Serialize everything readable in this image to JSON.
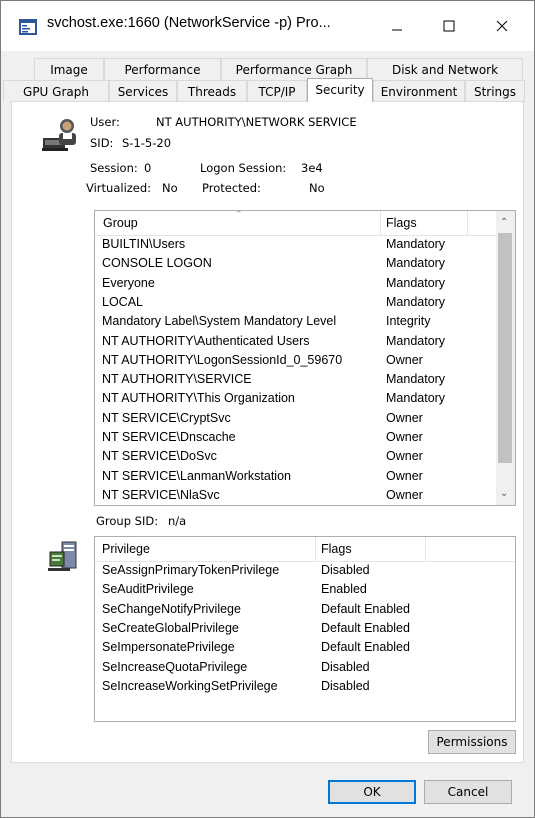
{
  "window": {
    "title": "svchost.exe:1660 (NetworkService -p) Pro..."
  },
  "tabs_row1": [
    "Image",
    "Performance",
    "Performance Graph",
    "Disk and Network"
  ],
  "tabs_row2": [
    "GPU Graph",
    "Services",
    "Threads",
    "TCP/IP",
    "Security",
    "Environment",
    "Strings"
  ],
  "active_tab": "Security",
  "user_info": {
    "user_label": "User:",
    "user_value": "NT AUTHORITY\\NETWORK SERVICE",
    "sid_label": "SID:",
    "sid_value": "S-1-5-20",
    "session_label": "Session:",
    "session_value": "0",
    "logon_session_label": "Logon Session:",
    "logon_session_value": "3e4",
    "virtualized_label": "Virtualized:",
    "virtualized_value": "No",
    "protected_label": "Protected:",
    "protected_value": "No"
  },
  "groups": {
    "columns": [
      "Group",
      "Flags"
    ],
    "rows": [
      [
        "BUILTIN\\Users",
        "Mandatory"
      ],
      [
        "CONSOLE LOGON",
        "Mandatory"
      ],
      [
        "Everyone",
        "Mandatory"
      ],
      [
        "LOCAL",
        "Mandatory"
      ],
      [
        "Mandatory Label\\System Mandatory Level",
        "Integrity"
      ],
      [
        "NT AUTHORITY\\Authenticated Users",
        "Mandatory"
      ],
      [
        "NT AUTHORITY\\LogonSessionId_0_59670",
        "Owner"
      ],
      [
        "NT AUTHORITY\\SERVICE",
        "Mandatory"
      ],
      [
        "NT AUTHORITY\\This Organization",
        "Mandatory"
      ],
      [
        "NT SERVICE\\CryptSvc",
        "Owner"
      ],
      [
        "NT SERVICE\\Dnscache",
        "Owner"
      ],
      [
        "NT SERVICE\\DoSvc",
        "Owner"
      ],
      [
        "NT SERVICE\\LanmanWorkstation",
        "Owner"
      ],
      [
        "NT SERVICE\\NlaSvc",
        "Owner"
      ]
    ]
  },
  "group_sid": {
    "label": "Group SID:",
    "value": "n/a"
  },
  "privileges": {
    "columns": [
      "Privilege",
      "Flags"
    ],
    "rows": [
      [
        "SeAssignPrimaryTokenPrivilege",
        "Disabled"
      ],
      [
        "SeAuditPrivilege",
        "Enabled"
      ],
      [
        "SeChangeNotifyPrivilege",
        "Default Enabled"
      ],
      [
        "SeCreateGlobalPrivilege",
        "Default Enabled"
      ],
      [
        "SeImpersonatePrivilege",
        "Default Enabled"
      ],
      [
        "SeIncreaseQuotaPrivilege",
        "Disabled"
      ],
      [
        "SeIncreaseWorkingSetPrivilege",
        "Disabled"
      ]
    ]
  },
  "buttons": {
    "permissions": "Permissions",
    "ok": "OK",
    "cancel": "Cancel"
  }
}
